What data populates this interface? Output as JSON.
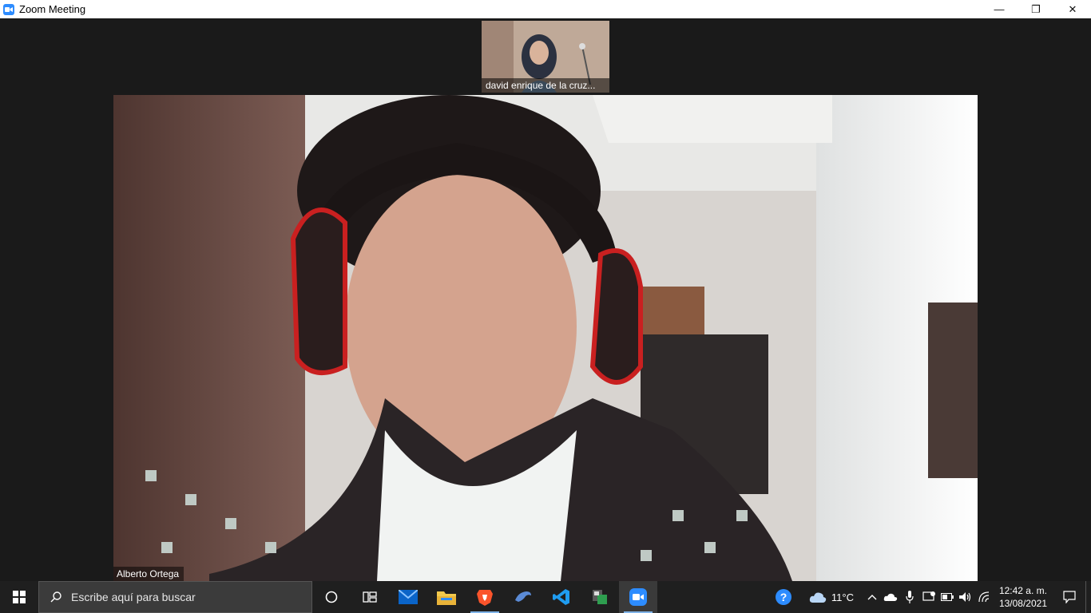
{
  "window": {
    "title": "Zoom Meeting",
    "controls": {
      "minimize": "—",
      "restore": "❐",
      "close": "✕"
    }
  },
  "meeting": {
    "thumbnail": {
      "name": "david enrique de la cruz..."
    },
    "active_speaker": {
      "name": "Alberto Ortega"
    }
  },
  "taskbar": {
    "search_placeholder": "Escribe aquí para buscar",
    "apps": [
      {
        "name": "cortana",
        "icon": "circle-icon"
      },
      {
        "name": "task-view",
        "icon": "task-view-icon"
      },
      {
        "name": "mail",
        "icon": "mail-icon"
      },
      {
        "name": "file-explorer",
        "icon": "folder-icon"
      },
      {
        "name": "brave",
        "icon": "brave-icon"
      },
      {
        "name": "dolphin",
        "icon": "dolphin-icon"
      },
      {
        "name": "vscode",
        "icon": "vscode-icon"
      },
      {
        "name": "app-8",
        "icon": "app-icon"
      },
      {
        "name": "zoom",
        "icon": "zoom-icon",
        "active": true
      }
    ],
    "tray": {
      "weather": "11°C",
      "time": "12:42 a. m.",
      "date": "13/08/2021"
    }
  }
}
